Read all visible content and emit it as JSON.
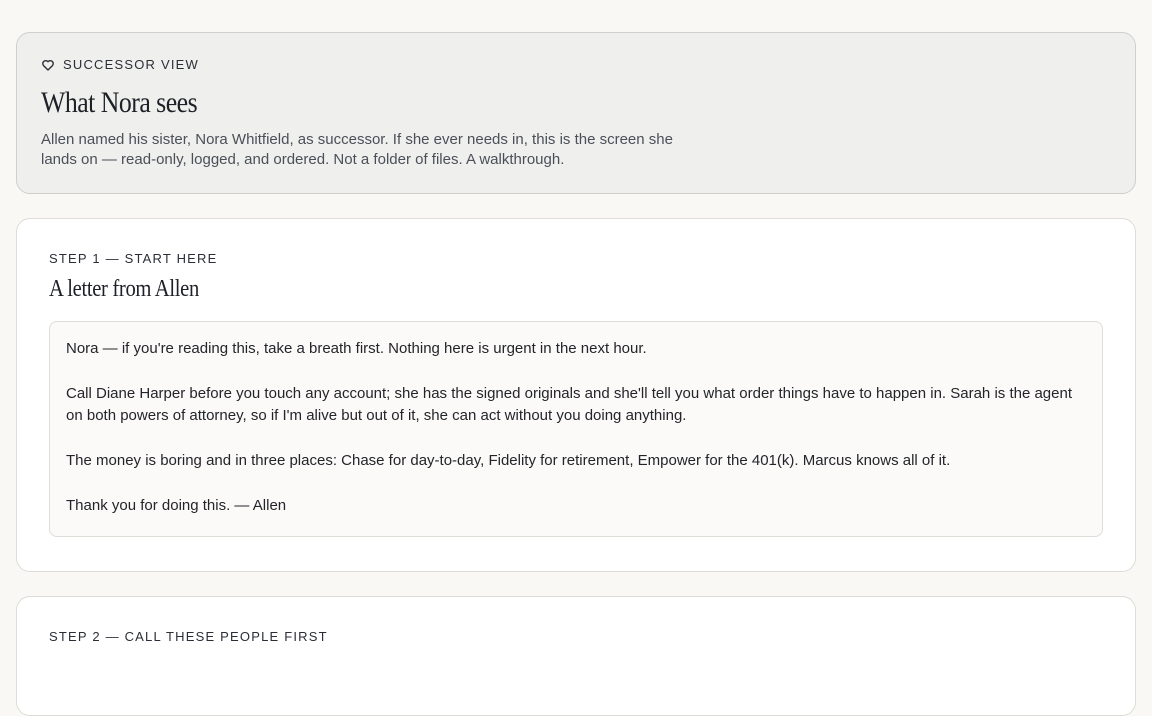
{
  "hero": {
    "eyebrow": "SUCCESSOR VIEW",
    "eyebrow_icon": "heart-icon",
    "title": "What Nora sees",
    "description": "Allen named his sister, Nora Whitfield, as successor. If she ever needs in, this is the screen she lands on — read-only, logged, and ordered. Not a folder of files. A walkthrough."
  },
  "steps": [
    {
      "label": "STEP 1 — START HERE",
      "title": "A letter from Allen",
      "letter": [
        "Nora — if you're reading this, take a breath first. Nothing here is urgent in the next hour.",
        "Call Diane Harper before you touch any account; she has the signed originals and she'll tell you what order things have to happen in. Sarah is the agent on both powers of attorney, so if I'm alive but out of it, she can act without you doing anything.",
        "The money is boring and in three places: Chase for day-to-day, Fidelity for retirement, Empower for the 401(k). Marcus knows all of it.",
        "Thank you for doing this. — Allen"
      ]
    },
    {
      "label": "STEP 2 — CALL THESE PEOPLE FIRST"
    }
  ]
}
